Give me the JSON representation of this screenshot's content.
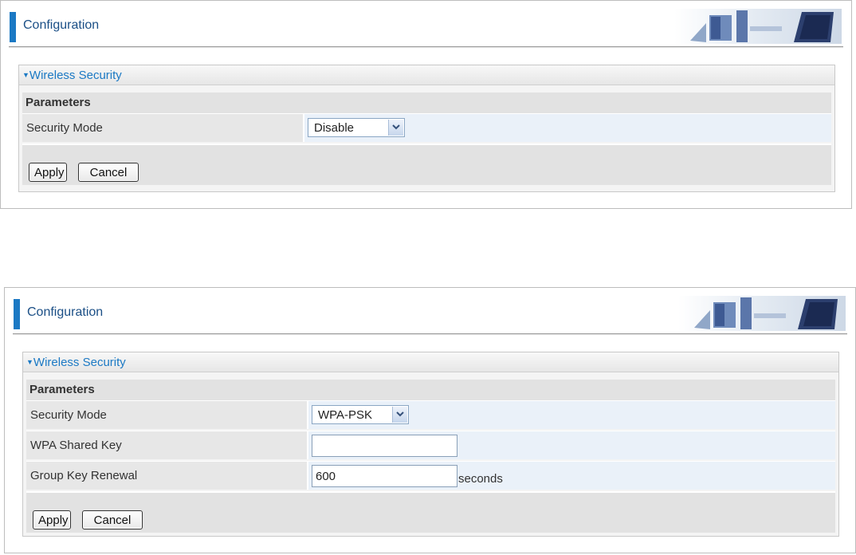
{
  "panel1": {
    "header_title": "Configuration",
    "section_title": "Wireless Security",
    "params_label": "Parameters",
    "security_mode_label": "Security Mode",
    "security_mode_value": "Disable",
    "apply_label": "Apply",
    "cancel_label": "Cancel"
  },
  "panel2": {
    "header_title": "Configuration",
    "section_title": "Wireless Security",
    "params_label": "Parameters",
    "security_mode_label": "Security Mode",
    "security_mode_value": "WPA-PSK",
    "wpa_key_label": "WPA Shared Key",
    "wpa_key_value": "",
    "group_key_label": "Group Key Renewal",
    "group_key_value": "600",
    "group_key_unit": "seconds",
    "apply_label": "Apply",
    "cancel_label": "Cancel"
  },
  "icons": {
    "section_toggle": "triangle-down-icon",
    "select_dropdown": "chevron-down-icon",
    "header_art": "office-chairs-banner"
  },
  "colors": {
    "accent": "#1b79c4",
    "header_text": "#1b4f86",
    "field_row_bg": "#eaf1f9",
    "label_bg": "#e7e7e7"
  }
}
